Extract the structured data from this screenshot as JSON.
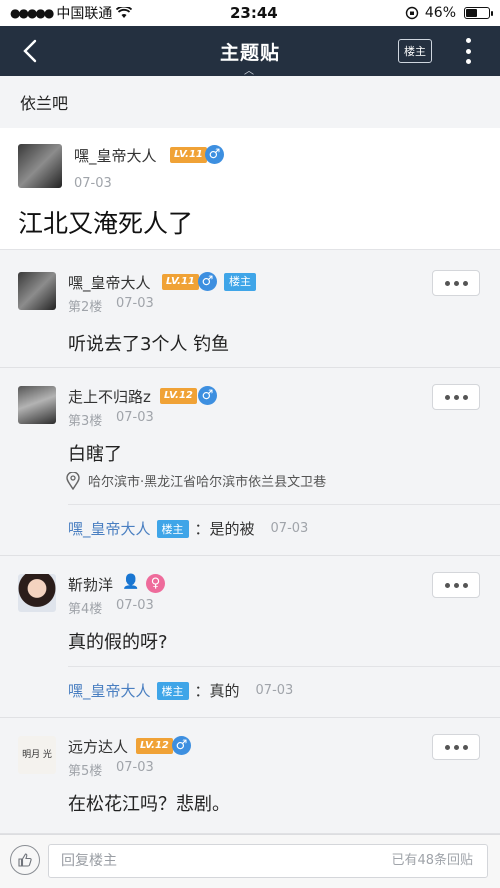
{
  "status_bar": {
    "carrier": "中国联通",
    "time": "23:44",
    "battery": "46%"
  },
  "nav": {
    "title": "主题贴",
    "louzhu_label": "楼主"
  },
  "forum": {
    "name": "依兰吧"
  },
  "op": {
    "username": "嘿_皇帝大人",
    "level": "LV.11",
    "date": "07-03",
    "content": "江北又淹死人了"
  },
  "floors": [
    {
      "username": "嘿_皇帝大人",
      "level": "LV.11",
      "badge": "楼主",
      "floor": "第2楼",
      "date": "07-03",
      "content": "听说去了3个人 钓鱼"
    },
    {
      "username": "走上不归路z",
      "level": "LV.12",
      "floor": "第3楼",
      "date": "07-03",
      "content": "白瞎了",
      "location": "哈尔滨市·黑龙江省哈尔滨市依兰县文卫巷",
      "sub_reply": {
        "username": "嘿_皇帝大人",
        "badge": "楼主",
        "text": "：是的被",
        "date": "07-03"
      }
    },
    {
      "username": "靳勃洋",
      "floor": "第4楼",
      "date": "07-03",
      "content": "真的假的呀?",
      "sub_reply": {
        "username": "嘿_皇帝大人",
        "badge": "楼主",
        "text": "：真的",
        "date": "07-03"
      }
    },
    {
      "username": "远方达人",
      "level": "LV.12",
      "floor": "第5楼",
      "date": "07-03",
      "content": "在松花江吗？悲剧。",
      "avatar_text": "明月 光"
    }
  ],
  "bottom": {
    "reply_placeholder": "回复楼主",
    "reply_count": "已有48条回贴"
  },
  "colors": {
    "nav_bg": "#243040",
    "level_badge": "#f0a236",
    "louzhu_badge": "#3fa5e8",
    "male": "#3d8fe0",
    "female": "#ee6b9b",
    "link": "#4a7fc1"
  }
}
